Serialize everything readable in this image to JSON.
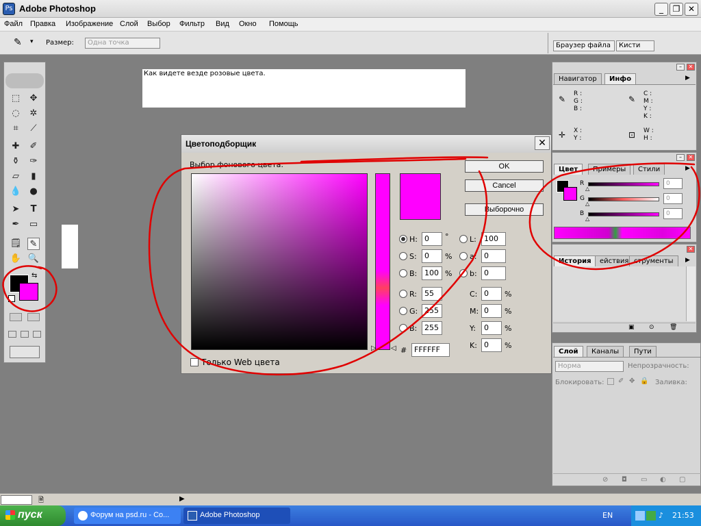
{
  "window": {
    "title": "Adobe Photoshop"
  },
  "menu": [
    "Файл",
    "Правка",
    "Изображение",
    "Слой",
    "Выбор",
    "Фильтр",
    "Вид",
    "Окно",
    "Помощь"
  ],
  "options": {
    "size_label": "Размер:",
    "size_value": "Одна точка",
    "tab_file_browser": "Браузер файла",
    "tab_brushes": "Кисти"
  },
  "note": "Как видете везде розовые цвета.",
  "dialog": {
    "title": "Цветоподборщик",
    "subtitle": "Выбор фонового цвета:",
    "ok": "OK",
    "cancel": "Cancel",
    "custom": "Выборочно",
    "web_only": "Только Web цвета",
    "hsb": {
      "H": "0",
      "S": "0",
      "B": "100"
    },
    "rgb": {
      "R": "55",
      "G": "255",
      "B": "255"
    },
    "lab": {
      "L": "100",
      "a": "0",
      "b": "0"
    },
    "cmyk": {
      "C": "0",
      "M": "0",
      "Y": "0",
      "K": "0"
    },
    "hex": "FFFFFF",
    "deg": "°",
    "pct": "%"
  },
  "panels": {
    "nav_tab": "Навигатор",
    "info_tab": "Инфо",
    "info_left": [
      "R :",
      "G :",
      "B :"
    ],
    "info_right": [
      "C :",
      "M :",
      "Y :",
      "K :"
    ],
    "info_xy": [
      "X :",
      "Y :"
    ],
    "info_wh": [
      "W :",
      "H :"
    ],
    "color_tab": "Цвет",
    "swatches_tab": "Примеры",
    "styles_tab": "Стили",
    "color_values": [
      "0",
      "0",
      "0"
    ],
    "color_labels": [
      "R",
      "G",
      "B"
    ],
    "history_tab": "История",
    "actions_tab": "ействия",
    "tools_tab": "струменты",
    "layers_tab": "Слой",
    "channels_tab": "Каналы",
    "paths_tab": "Пути",
    "blend_mode": "Норма",
    "opacity_label": "Непрозрачность:",
    "lock_label": "Блокировать:",
    "fill_label": "Заливка:"
  },
  "taskbar": {
    "start": "пуск",
    "task1": "Форум на psd.ru - Co...",
    "task2": "Adobe Photoshop",
    "lang": "EN",
    "time": "21:53"
  },
  "colors": {
    "magenta": "#ff00ff",
    "annotation": "#e00000"
  }
}
